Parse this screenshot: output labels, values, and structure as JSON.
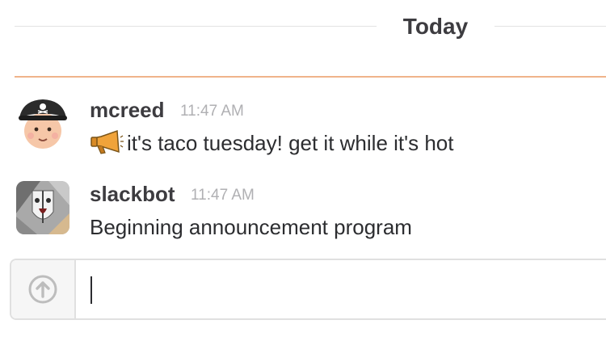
{
  "divider": {
    "label": "Today"
  },
  "messages": [
    {
      "author": "mcreed",
      "time": "11:47 AM",
      "text": "it's taco tuesday! get it while it's hot",
      "emoji": "loudspeaker-icon"
    },
    {
      "author": "slackbot",
      "time": "11:47 AM",
      "text": "Beginning announcement program"
    }
  ],
  "composer": {
    "value": "",
    "upload_icon": "upload-arrow-icon"
  },
  "colors": {
    "new_messages_line": "#f0b38a",
    "author": "#3d3c40",
    "timestamp": "#b0b0b3"
  }
}
